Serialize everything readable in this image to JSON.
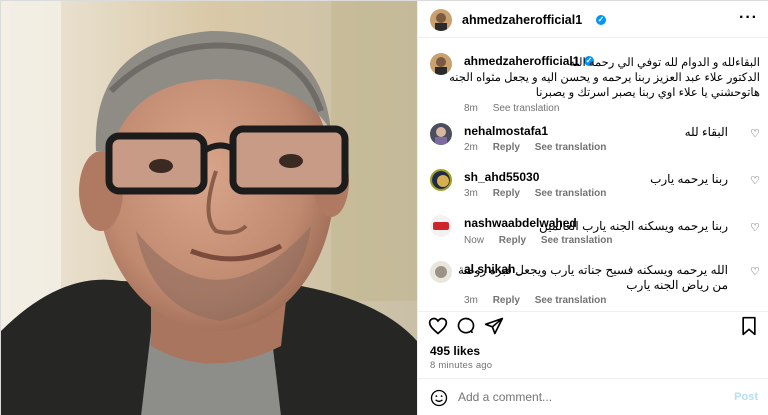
{
  "post": {
    "author": "ahmedzaherofficial1",
    "caption_author": "ahmedzaherofficial1",
    "caption_lines": [
      "البقاءلله و الدوام لله توفي الي رحمه الله",
      "الدكتور علاء عبد العزيز ربنا يرحمه و يحسن اليه و يجعل مثواه الجنه",
      "هاتوحشني يا علاء اوي ربنا يصبر اسرتك و يصبرنا"
    ],
    "caption_time": "8m",
    "see_translation": "See translation",
    "likes": "495 likes",
    "ago": "8 minutes ago"
  },
  "comments": [
    {
      "user": "nehalmostafa1",
      "text": [
        "البقاء لله"
      ],
      "time": "2m",
      "reply": "Reply",
      "translate": "See translation"
    },
    {
      "user": "sh_ahd55030",
      "text": [
        "ربنا يرحمه يارب"
      ],
      "time": "3m",
      "reply": "Reply",
      "translate": "See translation"
    },
    {
      "user": "nashwaabdelwahed",
      "text": [
        "ربنا يرحمه ويسكنه الجنه يارب العالمين"
      ],
      "time": "Now",
      "reply": "Reply",
      "translate": "See translation"
    },
    {
      "user": "al.shikah_",
      "text": [
        "الله يرحمه ويسكنه فسيح جناته يارب ويجعل قبره روضة",
        "من رياض الجنه يارب"
      ],
      "time": "3m",
      "reply": "Reply",
      "translate": "See translation"
    }
  ],
  "add_comment": {
    "placeholder": "Add a comment...",
    "post_label": "Post"
  },
  "icons": {
    "verified": "verified-badge-icon",
    "more": "more-options-icon",
    "like": "heart-icon",
    "comment": "comment-bubble-icon",
    "share": "paper-plane-icon",
    "save": "bookmark-icon",
    "emoji": "emoji-smile-icon"
  },
  "colors": {
    "link_blue": "#0095f6",
    "muted": "#737373",
    "post_disabled": "#b2dffc"
  }
}
